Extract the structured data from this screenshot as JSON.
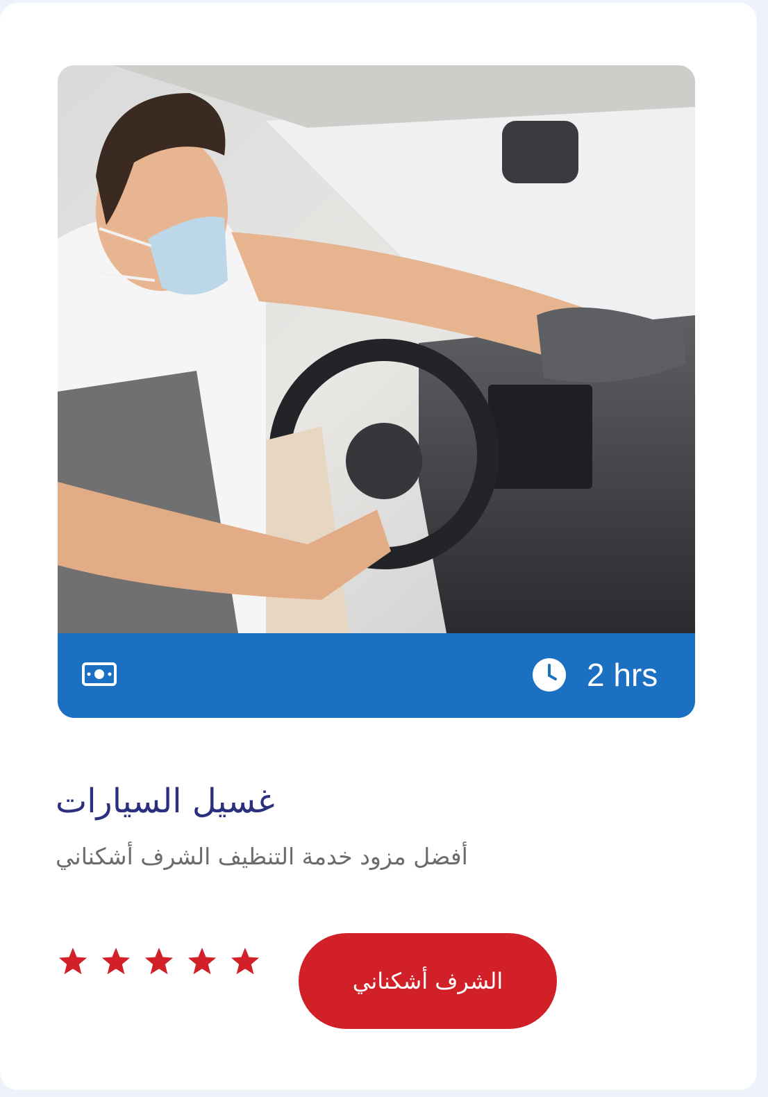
{
  "service": {
    "image_icon": "car-interior-cleaning-photo",
    "price_icon": "money-icon",
    "duration_icon": "clock-icon",
    "duration": "2 hrs",
    "title": "غسيل السيارات",
    "description": "أفضل مزود خدمة التنظيف الشرف أشكناني",
    "rating": 5,
    "rating_max": 5,
    "book_button_label": "الشرف أشكناني"
  },
  "colors": {
    "info_bar": "#1b70c1",
    "title": "#2b2f7e",
    "accent_red": "#d12027",
    "star": "#d12027"
  }
}
